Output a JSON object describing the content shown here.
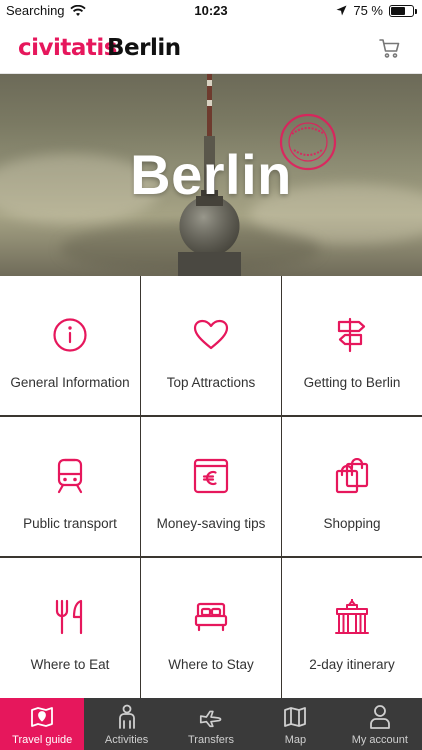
{
  "status_bar": {
    "carrier": "Searching",
    "time": "10:23",
    "battery": "75 %",
    "battery_level": 0.75
  },
  "header": {
    "brand": "civitatis",
    "city": "Berlin",
    "cart_icon": "cart-icon"
  },
  "hero": {
    "title": "Berlin",
    "stamp_icon": "official-guide-stamp"
  },
  "accent_color": "#e6175c",
  "tiles": [
    {
      "label": "General Information",
      "icon": "info-icon"
    },
    {
      "label": "Top Attractions",
      "icon": "heart-icon"
    },
    {
      "label": "Getting to Berlin",
      "icon": "signpost-icon"
    },
    {
      "label": "Public transport",
      "icon": "train-icon"
    },
    {
      "label": "Money-saving tips",
      "icon": "euro-wallet-icon"
    },
    {
      "label": "Shopping",
      "icon": "shopping-bags-icon"
    },
    {
      "label": "Where to Eat",
      "icon": "fork-knife-icon"
    },
    {
      "label": "Where to Stay",
      "icon": "bed-icon"
    },
    {
      "label": "2-day itinerary",
      "icon": "brandenburg-gate-icon"
    }
  ],
  "tabbar": {
    "items": [
      {
        "label": "Travel guide",
        "icon": "map-book-icon",
        "active": true
      },
      {
        "label": "Activities",
        "icon": "person-icon",
        "active": false
      },
      {
        "label": "Transfers",
        "icon": "plane-icon",
        "active": false
      },
      {
        "label": "Map",
        "icon": "map-icon",
        "active": false
      },
      {
        "label": "My account",
        "icon": "user-icon",
        "active": false
      }
    ]
  }
}
